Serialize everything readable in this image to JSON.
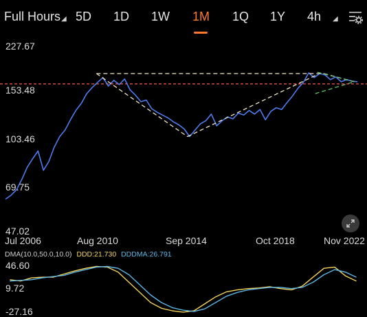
{
  "tabs": {
    "full_hours": "Full Hours",
    "items": [
      "5D",
      "1D",
      "1W",
      "1M",
      "1Q",
      "1Y",
      "4h"
    ],
    "active": "1M"
  },
  "chart_data": [
    {
      "type": "line",
      "y_ticks": [
        "227.67",
        "153.48",
        "103.46",
        "69.75",
        "47.02"
      ],
      "x_ticks": [
        "Jul 2006",
        "Aug 2010",
        "Sep 2014",
        "Oct 2018",
        "Nov 2022"
      ],
      "ylim": [
        47.02,
        227.67
      ],
      "y_scale": "log",
      "x_range": [
        2006.5,
        2023.0
      ],
      "series": [
        {
          "color": "#4f7df0",
          "x": [
            2006.5,
            2006.75,
            2007.0,
            2007.25,
            2007.5,
            2007.75,
            2008.0,
            2008.25,
            2008.5,
            2008.75,
            2009.0,
            2009.25,
            2009.5,
            2009.75,
            2010.0,
            2010.25,
            2010.5,
            2010.75,
            2011.0,
            2011.25,
            2011.5,
            2011.75,
            2012.0,
            2012.25,
            2012.5,
            2012.75,
            2013.0,
            2013.25,
            2013.5,
            2013.75,
            2014.0,
            2014.25,
            2014.5,
            2014.75,
            2015.0,
            2015.25,
            2015.5,
            2015.75,
            2016.0,
            2016.25,
            2016.5,
            2016.75,
            2017.0,
            2017.25,
            2017.5,
            2017.75,
            2018.0,
            2018.25,
            2018.5,
            2018.75,
            2019.0,
            2019.25,
            2019.5,
            2019.75,
            2020.0,
            2020.25,
            2020.5,
            2020.75,
            2021.0,
            2021.25,
            2021.5,
            2021.75,
            2022.0,
            2022.25,
            2022.5,
            2022.75
          ],
          "y": [
            61,
            63,
            66,
            72,
            80,
            86,
            92,
            78,
            84,
            95,
            104,
            110,
            120,
            130,
            138,
            150,
            158,
            165,
            172,
            160,
            168,
            162,
            170,
            155,
            148,
            140,
            142,
            132,
            128,
            125,
            122,
            118,
            115,
            111,
            104,
            110,
            116,
            119,
            126,
            114,
            119,
            123,
            121,
            127,
            125,
            130,
            126,
            131,
            120,
            129,
            133,
            131,
            139,
            147,
            157,
            165,
            179,
            172,
            178,
            176,
            169,
            173,
            166,
            169,
            167,
            166
          ]
        }
      ],
      "reference_line": {
        "y": 163.0,
        "color": "#ff5a4a",
        "style": "dashed"
      },
      "annotations": [
        {
          "kind": "dashed-line",
          "color": "#f0e6c8",
          "x": [
            2010.7,
            2014.9
          ],
          "y": [
            178,
            104
          ]
        },
        {
          "kind": "dashed-line",
          "color": "#f0e6c8",
          "x": [
            2014.9,
            2020.8
          ],
          "y": [
            104,
            175
          ]
        },
        {
          "kind": "dashed-line",
          "color": "#f0e6c8",
          "x": [
            2010.7,
            2021.2
          ],
          "y": [
            178,
            178
          ]
        },
        {
          "kind": "dashed-line",
          "color": "#f0e6c8",
          "x": [
            2021.2,
            2022.6
          ],
          "y": [
            178,
            166
          ]
        },
        {
          "kind": "dashed-line",
          "color": "#62c46a",
          "x": [
            2020.8,
            2022.6
          ],
          "y": [
            150,
            166
          ]
        },
        {
          "kind": "dashed-line",
          "color": "#62c46a",
          "x": [
            2020.9,
            2022.6
          ],
          "y": [
            180,
            166
          ]
        }
      ]
    },
    {
      "type": "line",
      "legend": [
        "DMA(10.0,50.0,10.0)",
        "DDD:21.730",
        "DDDMA:26.791"
      ],
      "y_ticks": [
        "46.60",
        "9.72",
        "-27.16"
      ],
      "ylim": [
        -27.16,
        46.6
      ],
      "series": [
        {
          "name": "DDD",
          "color": "#f5d45a",
          "x": [
            2006.7,
            2007.2,
            2007.7,
            2008.2,
            2008.7,
            2009.2,
            2009.7,
            2010.2,
            2010.7,
            2011.2,
            2011.7,
            2012.2,
            2012.7,
            2013.2,
            2013.7,
            2014.2,
            2014.7,
            2015.2,
            2015.7,
            2016.2,
            2016.7,
            2017.2,
            2017.7,
            2018.2,
            2018.7,
            2019.2,
            2019.7,
            2020.2,
            2020.7,
            2021.2,
            2021.7,
            2022.2,
            2022.7
          ],
          "y": [
            24,
            22,
            27,
            28,
            28,
            33,
            38,
            42,
            45,
            44,
            36,
            20,
            4,
            -12,
            -21,
            -25,
            -27,
            -25,
            -14,
            -3,
            5,
            8,
            10,
            11,
            13,
            10,
            8,
            14,
            28,
            42,
            44,
            30,
            22
          ]
        },
        {
          "name": "DDDMA",
          "color": "#5bb8e8",
          "x": [
            2006.7,
            2007.2,
            2007.7,
            2008.2,
            2008.7,
            2009.2,
            2009.7,
            2010.2,
            2010.7,
            2011.2,
            2011.7,
            2012.2,
            2012.7,
            2013.2,
            2013.7,
            2014.2,
            2014.7,
            2015.2,
            2015.7,
            2016.2,
            2016.7,
            2017.2,
            2017.7,
            2018.2,
            2018.7,
            2019.2,
            2019.7,
            2020.2,
            2020.7,
            2021.2,
            2021.7,
            2022.2,
            2022.7
          ],
          "y": [
            22,
            23,
            24,
            27,
            29,
            31,
            36,
            40,
            44,
            45,
            42,
            32,
            16,
            0,
            -12,
            -20,
            -24,
            -26,
            -22,
            -12,
            -2,
            4,
            8,
            10,
            12,
            12,
            10,
            12,
            20,
            32,
            40,
            36,
            28
          ]
        }
      ]
    }
  ],
  "colors": {
    "accent": "#ff7a2f",
    "price": "#4f7df0",
    "ddd": "#f5d45a",
    "dddma": "#5bb8e8",
    "ref": "#ff5a4a"
  },
  "icons": {
    "settings": "settings-icon",
    "fullscreen": "expand-icon"
  }
}
